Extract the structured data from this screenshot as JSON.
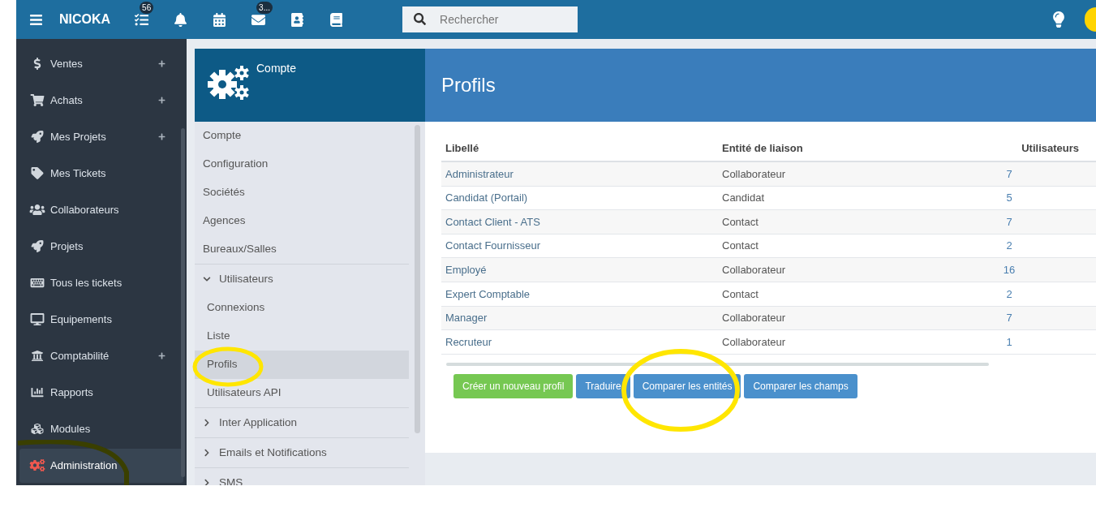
{
  "topbar": {
    "brand": "NICOKA",
    "tasks_badge": "56",
    "mail_badge": "3...",
    "search": {
      "placeholder": "Rechercher"
    }
  },
  "sidebar": {
    "items": [
      {
        "label": "Ventes",
        "expandable": true,
        "selected": false
      },
      {
        "label": "Achats",
        "expandable": true,
        "selected": false
      },
      {
        "label": "Mes Projets",
        "expandable": true,
        "selected": false
      },
      {
        "label": "Mes Tickets",
        "expandable": false,
        "selected": false
      },
      {
        "label": "Collaborateurs",
        "expandable": false,
        "selected": false
      },
      {
        "label": "Projets",
        "expandable": false,
        "selected": false
      },
      {
        "label": "Tous les tickets",
        "expandable": false,
        "selected": false
      },
      {
        "label": "Equipements",
        "expandable": false,
        "selected": false
      },
      {
        "label": "Comptabilité",
        "expandable": true,
        "selected": false
      },
      {
        "label": "Rapports",
        "expandable": false,
        "selected": false
      },
      {
        "label": "Modules",
        "expandable": false,
        "selected": false
      },
      {
        "label": "Administration",
        "expandable": false,
        "selected": true
      }
    ]
  },
  "submenu": {
    "title": "Compte",
    "items": [
      {
        "label": "Compte"
      },
      {
        "label": "Configuration"
      },
      {
        "label": "Sociétés"
      },
      {
        "label": "Agences"
      },
      {
        "label": "Bureaux/Salles"
      },
      {
        "label": "Utilisateurs",
        "expanded": true,
        "children": [
          {
            "label": "Connexions",
            "selected": false
          },
          {
            "label": "Liste",
            "selected": false
          },
          {
            "label": "Profils",
            "selected": true
          },
          {
            "label": "Utilisateurs API",
            "selected": false
          }
        ]
      },
      {
        "label": "Inter Application",
        "expanded": false
      },
      {
        "label": "Emails et Notifications",
        "expanded": false
      },
      {
        "label": "SMS",
        "expanded": false
      }
    ]
  },
  "panel": {
    "title": "Profils",
    "table": {
      "columns": [
        "Libellé",
        "Entité de liaison",
        "Utilisateurs"
      ],
      "rows": [
        [
          "Administrateur",
          "Collaborateur",
          "7"
        ],
        [
          "Candidat (Portail)",
          "Candidat",
          "5"
        ],
        [
          "Contact Client - ATS",
          "Contact",
          "7"
        ],
        [
          "Contact Fournisseur",
          "Contact",
          "2"
        ],
        [
          "Employé",
          "Collaborateur",
          "16"
        ],
        [
          "Expert Comptable",
          "Contact",
          "2"
        ],
        [
          "Manager",
          "Collaborateur",
          "7"
        ],
        [
          "Recruteur",
          "Collaborateur",
          "1"
        ]
      ]
    },
    "buttons": [
      {
        "label": "Créer un nouveau profil",
        "kind": "success"
      },
      {
        "label": "Traduire",
        "kind": "primary"
      },
      {
        "label": "Comparer les entités",
        "kind": "primary"
      },
      {
        "label": "Comparer les champs",
        "kind": "primary"
      }
    ]
  }
}
